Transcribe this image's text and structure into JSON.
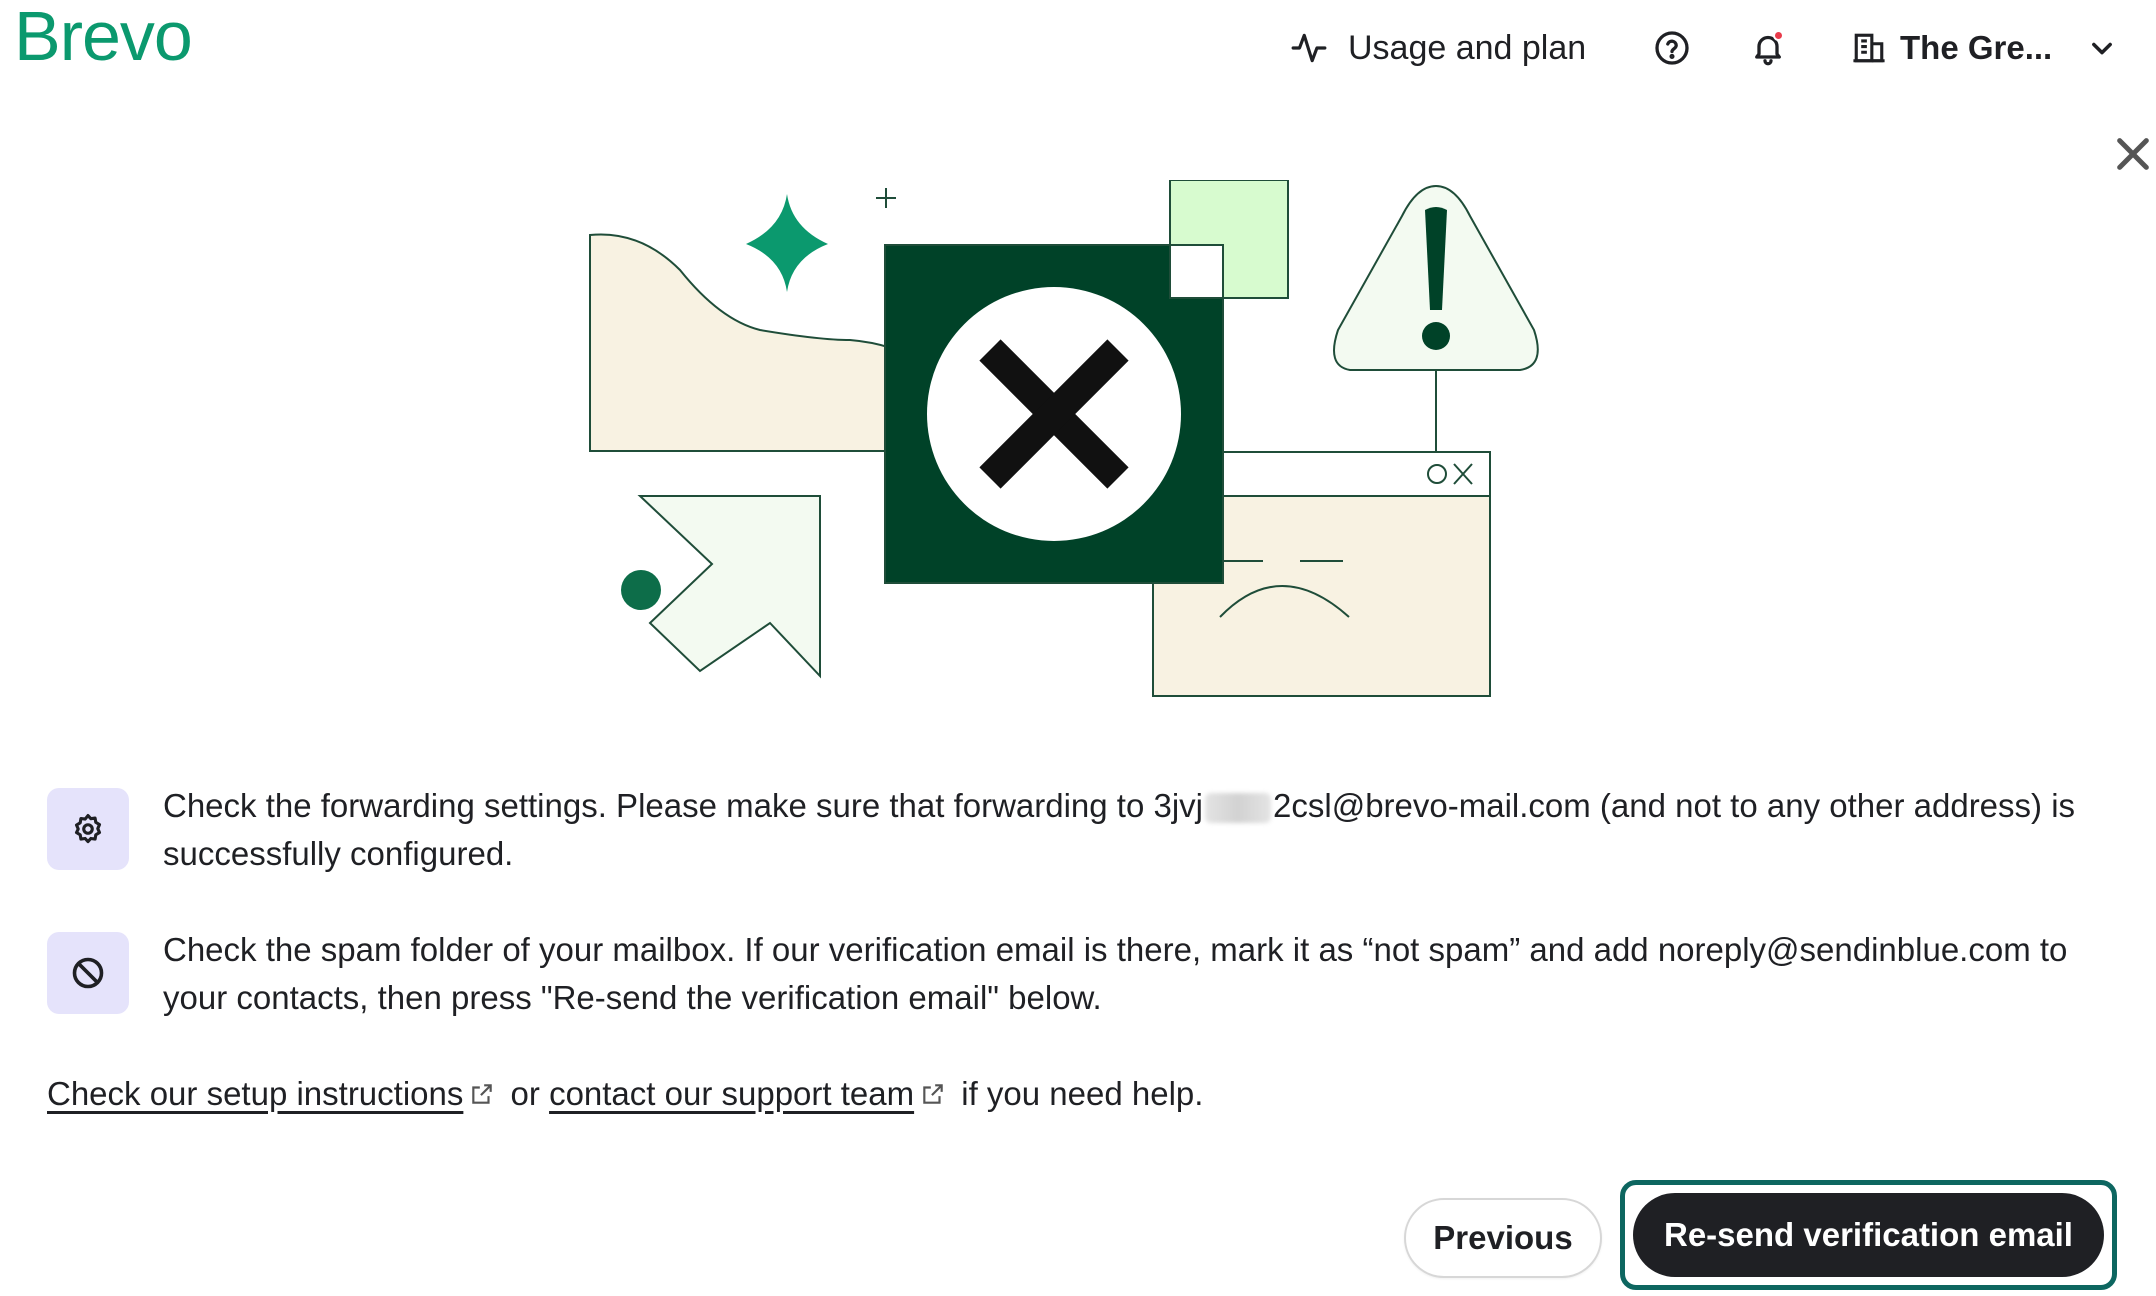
{
  "header": {
    "logo": "Brevo",
    "usage_label": "Usage and plan",
    "account_name": "The Gre...",
    "icons": {
      "usage": "activity-icon",
      "help": "help-circle-icon",
      "notifications": "bell-icon",
      "account": "building-icon",
      "account_menu": "chevron-down-icon"
    },
    "notification_dot_color": "#e93b4b"
  },
  "dialog": {
    "close_icon": "close-icon",
    "illustration_icon": "verification-failed-illustration"
  },
  "checks": [
    {
      "icon": "gear-icon",
      "text_before": "Check the forwarding settings. Please make sure that forwarding to 3jvj",
      "text_after": "2csl@brevo-mail.com (and not to any other address) is successfully configured."
    },
    {
      "icon": "block-icon",
      "text": "Check the spam folder of your mailbox. If our verification email is there, mark it as “not spam” and add noreply@sendinblue.com to your contacts, then press \"Re-send the verification email\" below."
    }
  ],
  "help": {
    "setup_link": "Check our setup instructions",
    "or_text": "or",
    "support_link": "contact our support team",
    "suffix": "if you need help.",
    "link_icon": "external-link-icon"
  },
  "actions": {
    "previous_label": "Previous",
    "resend_label": "Re-send verification email"
  },
  "colors": {
    "brand": "#0b996e",
    "dark_green": "#004228",
    "primary_button": "#1f2024",
    "focus_ring": "#0d6660",
    "icon_tile": "#e5e3fb"
  }
}
